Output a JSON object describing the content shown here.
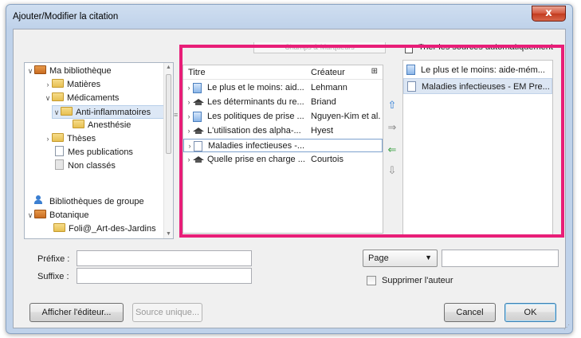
{
  "window": {
    "title": "Ajouter/Modifier la citation",
    "close_symbol": "x"
  },
  "library_tree": {
    "items": [
      {
        "label": "Ma bibliothèque",
        "icon": "library-icon"
      },
      {
        "label": "Matières",
        "icon": "folder-icon"
      },
      {
        "label": "Médicaments",
        "icon": "folder-icon"
      },
      {
        "label": "Anti-inflammatoires",
        "icon": "folder-icon"
      },
      {
        "label": "Anesthésie",
        "icon": "folder-icon"
      },
      {
        "label": "Thèses",
        "icon": "folder-icon"
      },
      {
        "label": "Mes publications",
        "icon": "document-icon"
      },
      {
        "label": "Non classés",
        "icon": "unfiled-icon"
      },
      {
        "label": "Bibliothèques de groupe",
        "icon": "group-icon"
      },
      {
        "label": "Botanique",
        "icon": "library-icon"
      },
      {
        "label": "Foli@_Art-des-Jardins",
        "icon": "folder-icon"
      }
    ]
  },
  "fields_header": "Champs & Marqueurs",
  "auto_sort_label": "Trier les sources automatiquement",
  "items_list": {
    "columns": {
      "title": "Titre",
      "creator": "Créateur"
    },
    "rows": [
      {
        "title": "Le plus et le moins: aid...",
        "creator": "Lehmann",
        "icon": "book-icon"
      },
      {
        "title": "Les déterminants du re...",
        "creator": "Briand",
        "icon": "thesis-icon"
      },
      {
        "title": "Les politiques de prise ...",
        "creator": "Nguyen-Kim et al.",
        "icon": "book-icon"
      },
      {
        "title": "L'utilisation des alpha-...",
        "creator": "Hyest",
        "icon": "thesis-icon"
      },
      {
        "title": "Maladies infectieuses -...",
        "creator": "",
        "icon": "document-icon"
      },
      {
        "title": "Quelle prise en charge ...",
        "creator": "Courtois",
        "icon": "thesis-icon"
      }
    ]
  },
  "move_buttons": {
    "up": "⇧",
    "right": "⇒",
    "left": "⇐",
    "down": "⇩"
  },
  "selected_sources": [
    {
      "title": "Le plus et le moins: aide-mém...",
      "icon": "book-icon"
    },
    {
      "title": "Maladies infectieuses - EM Pre...",
      "icon": "document-icon"
    }
  ],
  "citation": {
    "prefix_label": "Préfixe :",
    "suffix_label": "Suffixe :",
    "prefix_value": "",
    "suffix_value": "",
    "locator_type": "Page",
    "locator_value": "",
    "suppress_author_label": "Supprimer l'auteur"
  },
  "buttons": {
    "show_editor": "Afficher l'éditeur...",
    "single_source": "Source unique...",
    "cancel": "Cancel",
    "ok": "OK"
  },
  "colors": {
    "annotation": "#e81e78",
    "selection": "#dce6f3"
  }
}
